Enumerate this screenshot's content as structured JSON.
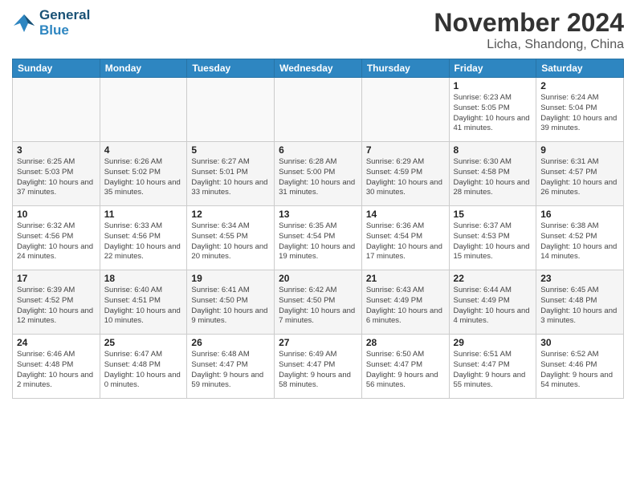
{
  "header": {
    "logo_line1": "General",
    "logo_line2": "Blue",
    "title": "November 2024",
    "subtitle": "Licha, Shandong, China"
  },
  "days_of_week": [
    "Sunday",
    "Monday",
    "Tuesday",
    "Wednesday",
    "Thursday",
    "Friday",
    "Saturday"
  ],
  "weeks": [
    [
      {
        "day": "",
        "empty": true
      },
      {
        "day": "",
        "empty": true
      },
      {
        "day": "",
        "empty": true
      },
      {
        "day": "",
        "empty": true
      },
      {
        "day": "",
        "empty": true
      },
      {
        "day": "1",
        "info": "Sunrise: 6:23 AM\nSunset: 5:05 PM\nDaylight: 10 hours and 41 minutes."
      },
      {
        "day": "2",
        "info": "Sunrise: 6:24 AM\nSunset: 5:04 PM\nDaylight: 10 hours and 39 minutes."
      }
    ],
    [
      {
        "day": "3",
        "info": "Sunrise: 6:25 AM\nSunset: 5:03 PM\nDaylight: 10 hours and 37 minutes."
      },
      {
        "day": "4",
        "info": "Sunrise: 6:26 AM\nSunset: 5:02 PM\nDaylight: 10 hours and 35 minutes."
      },
      {
        "day": "5",
        "info": "Sunrise: 6:27 AM\nSunset: 5:01 PM\nDaylight: 10 hours and 33 minutes."
      },
      {
        "day": "6",
        "info": "Sunrise: 6:28 AM\nSunset: 5:00 PM\nDaylight: 10 hours and 31 minutes."
      },
      {
        "day": "7",
        "info": "Sunrise: 6:29 AM\nSunset: 4:59 PM\nDaylight: 10 hours and 30 minutes."
      },
      {
        "day": "8",
        "info": "Sunrise: 6:30 AM\nSunset: 4:58 PM\nDaylight: 10 hours and 28 minutes."
      },
      {
        "day": "9",
        "info": "Sunrise: 6:31 AM\nSunset: 4:57 PM\nDaylight: 10 hours and 26 minutes."
      }
    ],
    [
      {
        "day": "10",
        "info": "Sunrise: 6:32 AM\nSunset: 4:56 PM\nDaylight: 10 hours and 24 minutes."
      },
      {
        "day": "11",
        "info": "Sunrise: 6:33 AM\nSunset: 4:56 PM\nDaylight: 10 hours and 22 minutes."
      },
      {
        "day": "12",
        "info": "Sunrise: 6:34 AM\nSunset: 4:55 PM\nDaylight: 10 hours and 20 minutes."
      },
      {
        "day": "13",
        "info": "Sunrise: 6:35 AM\nSunset: 4:54 PM\nDaylight: 10 hours and 19 minutes."
      },
      {
        "day": "14",
        "info": "Sunrise: 6:36 AM\nSunset: 4:54 PM\nDaylight: 10 hours and 17 minutes."
      },
      {
        "day": "15",
        "info": "Sunrise: 6:37 AM\nSunset: 4:53 PM\nDaylight: 10 hours and 15 minutes."
      },
      {
        "day": "16",
        "info": "Sunrise: 6:38 AM\nSunset: 4:52 PM\nDaylight: 10 hours and 14 minutes."
      }
    ],
    [
      {
        "day": "17",
        "info": "Sunrise: 6:39 AM\nSunset: 4:52 PM\nDaylight: 10 hours and 12 minutes."
      },
      {
        "day": "18",
        "info": "Sunrise: 6:40 AM\nSunset: 4:51 PM\nDaylight: 10 hours and 10 minutes."
      },
      {
        "day": "19",
        "info": "Sunrise: 6:41 AM\nSunset: 4:50 PM\nDaylight: 10 hours and 9 minutes."
      },
      {
        "day": "20",
        "info": "Sunrise: 6:42 AM\nSunset: 4:50 PM\nDaylight: 10 hours and 7 minutes."
      },
      {
        "day": "21",
        "info": "Sunrise: 6:43 AM\nSunset: 4:49 PM\nDaylight: 10 hours and 6 minutes."
      },
      {
        "day": "22",
        "info": "Sunrise: 6:44 AM\nSunset: 4:49 PM\nDaylight: 10 hours and 4 minutes."
      },
      {
        "day": "23",
        "info": "Sunrise: 6:45 AM\nSunset: 4:48 PM\nDaylight: 10 hours and 3 minutes."
      }
    ],
    [
      {
        "day": "24",
        "info": "Sunrise: 6:46 AM\nSunset: 4:48 PM\nDaylight: 10 hours and 2 minutes."
      },
      {
        "day": "25",
        "info": "Sunrise: 6:47 AM\nSunset: 4:48 PM\nDaylight: 10 hours and 0 minutes."
      },
      {
        "day": "26",
        "info": "Sunrise: 6:48 AM\nSunset: 4:47 PM\nDaylight: 9 hours and 59 minutes."
      },
      {
        "day": "27",
        "info": "Sunrise: 6:49 AM\nSunset: 4:47 PM\nDaylight: 9 hours and 58 minutes."
      },
      {
        "day": "28",
        "info": "Sunrise: 6:50 AM\nSunset: 4:47 PM\nDaylight: 9 hours and 56 minutes."
      },
      {
        "day": "29",
        "info": "Sunrise: 6:51 AM\nSunset: 4:47 PM\nDaylight: 9 hours and 55 minutes."
      },
      {
        "day": "30",
        "info": "Sunrise: 6:52 AM\nSunset: 4:46 PM\nDaylight: 9 hours and 54 minutes."
      }
    ]
  ]
}
